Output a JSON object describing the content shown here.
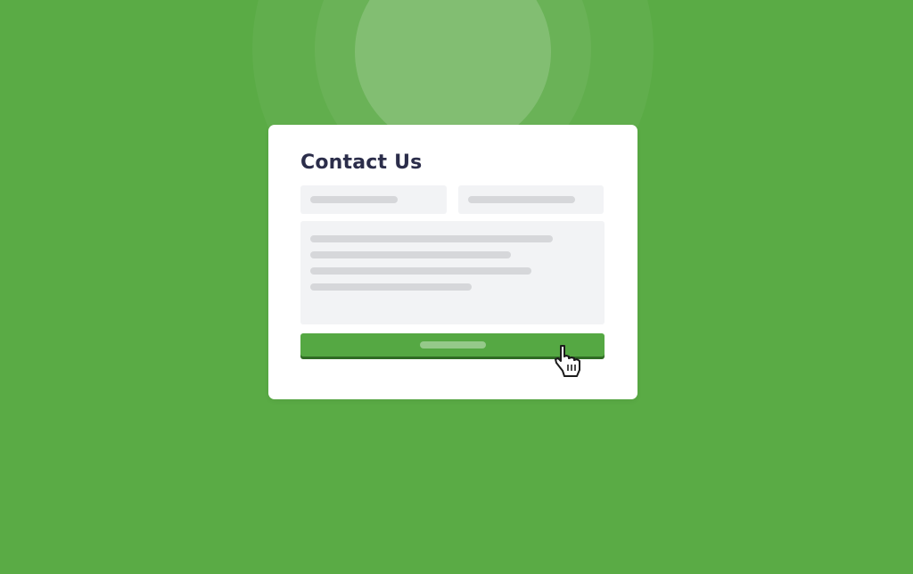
{
  "form": {
    "title": "Contact Us"
  },
  "colors": {
    "background": "#5aab45",
    "card": "#ffffff",
    "title_text": "#2b2d4a",
    "field_background": "#f2f3f5",
    "placeholder_bar": "#d6d7da",
    "submit_button": "#55a843"
  },
  "icons": {
    "pointer": "hand-pointer-icon"
  }
}
